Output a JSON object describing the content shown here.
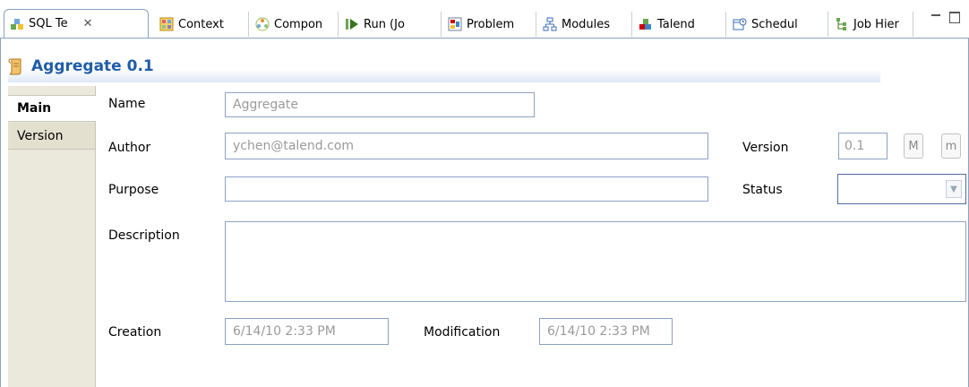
{
  "tabs": [
    {
      "label": "SQL Te",
      "icon": "sql-templates-icon",
      "active": true
    },
    {
      "label": "Context",
      "icon": "context-icon"
    },
    {
      "label": "Compon",
      "icon": "components-icon"
    },
    {
      "label": "Run (Jo",
      "icon": "run-icon"
    },
    {
      "label": "Problem",
      "icon": "problems-icon"
    },
    {
      "label": "Modules",
      "icon": "modules-icon"
    },
    {
      "label": "Talend",
      "icon": "talend-icon"
    },
    {
      "label": "Schedul",
      "icon": "scheduler-icon"
    },
    {
      "label": "Job Hier",
      "icon": "job-hierarchy-icon"
    }
  ],
  "close_glyph": "✕",
  "header": {
    "title": "Aggregate 0.1",
    "icon": "sql-template-doc-icon"
  },
  "side_tabs": [
    {
      "label": "Main",
      "selected": true
    },
    {
      "label": "Version",
      "selected": false
    }
  ],
  "form": {
    "name_label": "Name",
    "name_value": "Aggregate",
    "author_label": "Author",
    "author_value": "ychen@talend.com",
    "version_label": "Version",
    "version_value": "0.1",
    "major_button": "M",
    "minor_button": "m",
    "purpose_label": "Purpose",
    "purpose_value": "",
    "status_label": "Status",
    "status_value": "",
    "description_label": "Description",
    "description_value": "",
    "creation_label": "Creation",
    "creation_value": "6/14/10 2:33 PM",
    "modification_label": "Modification",
    "modification_value": "6/14/10 2:33 PM"
  },
  "colors": {
    "accent": "#1f5da8",
    "border": "#8da1c5",
    "side_bg": "#ebe9dc"
  }
}
